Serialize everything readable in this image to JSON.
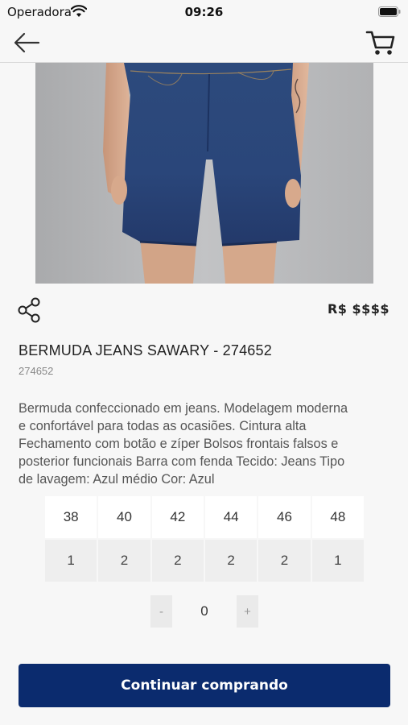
{
  "status_bar": {
    "carrier": "Operadora",
    "time": "09:26",
    "icons": [
      "wifi-icon",
      "battery-icon"
    ]
  },
  "nav": {
    "back_icon": "arrow-left-icon",
    "cart_icon": "shopping-cart-icon"
  },
  "gallery": {
    "image_subject": "denim bermuda shorts on model",
    "total_images": 8,
    "active_index": 0
  },
  "product": {
    "share_icon": "share-icon",
    "price": "R$ $$$$",
    "title": "BERMUDA JEANS SAWARY - 274652",
    "code": "274652",
    "description_lines": [
      "Bermuda confeccionado em jeans. Modelagem moderna",
      "e confortável para todas as ocasiões. Cintura alta",
      "Fechamento com botão e zíper Bolsos frontais falsos e",
      "posterior funcionais Barra com fenda Tecido: Jeans Tipo",
      "de lavagem: Azul médio Cor: Azul"
    ]
  },
  "sizes": [
    {
      "size": "38",
      "qty": "1"
    },
    {
      "size": "40",
      "qty": "2"
    },
    {
      "size": "42",
      "qty": "2"
    },
    {
      "size": "44",
      "qty": "2"
    },
    {
      "size": "46",
      "qty": "2"
    },
    {
      "size": "48",
      "qty": "1"
    }
  ],
  "stepper": {
    "minus_label": "-",
    "value": "0",
    "plus_label": "+"
  },
  "cta": {
    "label": "Continuar comprando",
    "color": "#0b2b6e"
  }
}
